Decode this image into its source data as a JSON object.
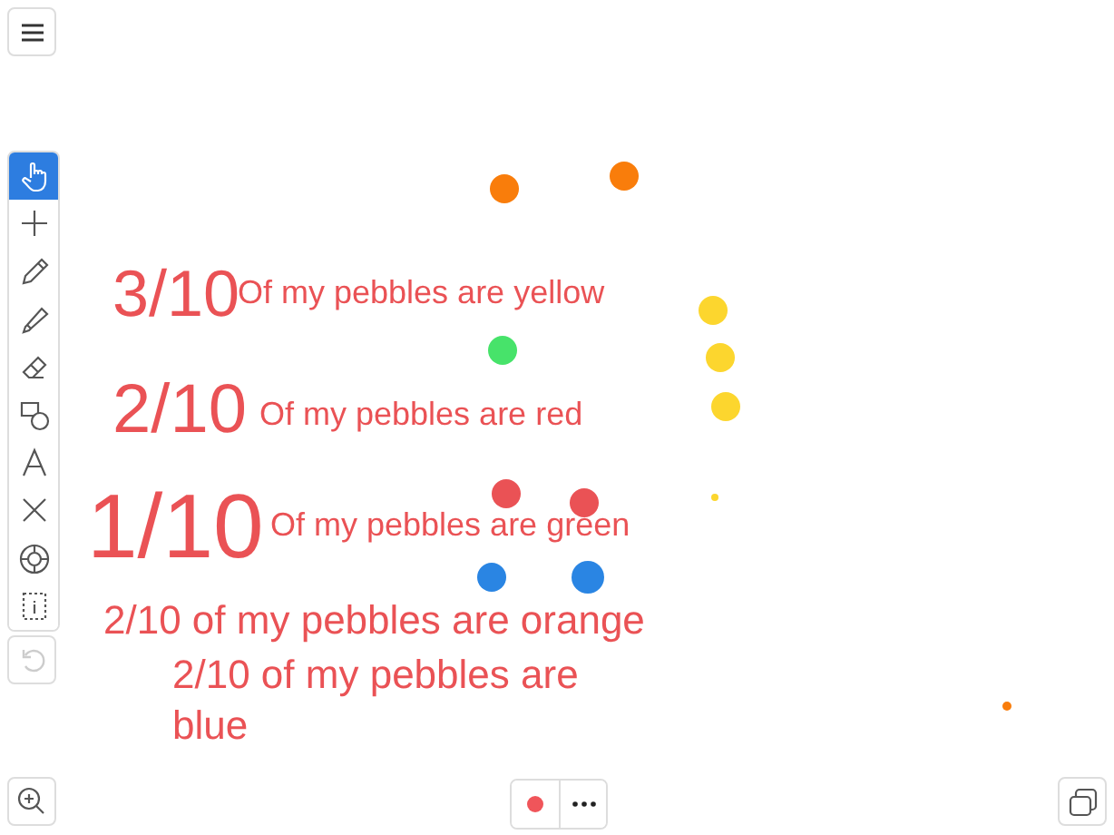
{
  "tools": [
    {
      "kind": "hand",
      "selected": true
    },
    {
      "kind": "plus",
      "selected": false
    },
    {
      "kind": "pencil",
      "selected": false
    },
    {
      "kind": "marker",
      "selected": false
    },
    {
      "kind": "eraser",
      "selected": false
    },
    {
      "kind": "shapes",
      "selected": false
    },
    {
      "kind": "text",
      "selected": false
    },
    {
      "kind": "cross",
      "selected": false
    },
    {
      "kind": "target",
      "selected": false
    },
    {
      "kind": "select",
      "selected": false
    }
  ],
  "undo": {
    "disabled": true
  },
  "notes": [
    {
      "fraction": "3/10",
      "caption": "Of my pebbles are yellow"
    },
    {
      "fraction": "2/10",
      "caption": "Of my pebbles are red"
    },
    {
      "fraction": "1/10",
      "caption": "Of my pebbles are green"
    }
  ],
  "sentences": [
    "2/10 of my pebbles are orange",
    "2/10 of my pebbles are blue"
  ],
  "pebbles": [
    {
      "color": "#f97d0b"
    },
    {
      "color": "#f97d0b"
    },
    {
      "color": "#fcd62e"
    },
    {
      "color": "#fcd62e"
    },
    {
      "color": "#fcd62e"
    },
    {
      "color": "#47e36a"
    },
    {
      "color": "#ea5255"
    },
    {
      "color": "#ea5255"
    },
    {
      "color": "#2a85e3"
    },
    {
      "color": "#2a85e3"
    },
    {
      "color": "#fcd62e"
    },
    {
      "color": "#f97d0b"
    }
  ],
  "recorder": {
    "recording": true
  }
}
